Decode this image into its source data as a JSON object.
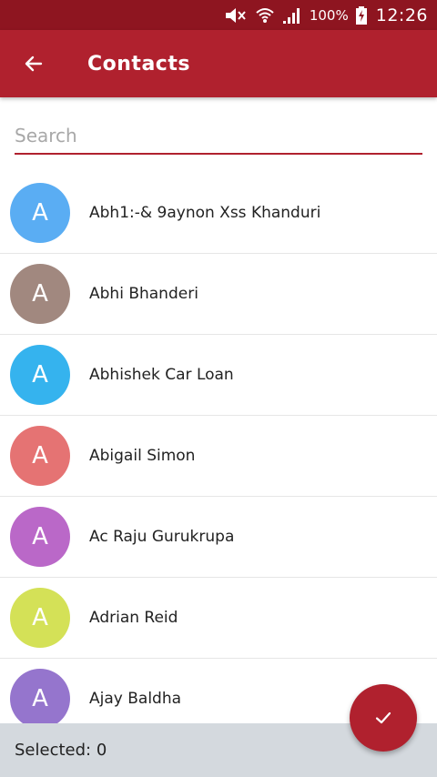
{
  "status_bar": {
    "battery": "100%",
    "time": "12:26",
    "icons": [
      "mute-icon",
      "wifi-icon",
      "signal-icon",
      "battery-charging-icon"
    ]
  },
  "app_bar": {
    "title": "Contacts",
    "back_icon": "arrow-left-icon"
  },
  "search": {
    "placeholder": "Search",
    "value": ""
  },
  "contacts": [
    {
      "initial": "A",
      "name": "Abh1:-& 9aynon Xss Khanduri",
      "color": "#5aadf3"
    },
    {
      "initial": "A",
      "name": "Abhi Bhanderi",
      "color": "#a1887f"
    },
    {
      "initial": "A",
      "name": "Abhishek Car Loan",
      "color": "#35b3ee"
    },
    {
      "initial": "A",
      "name": "Abigail Simon",
      "color": "#e57373"
    },
    {
      "initial": "A",
      "name": "Ac Raju Gurukrupa",
      "color": "#ba68c8"
    },
    {
      "initial": "A",
      "name": "Adrian Reid",
      "color": "#d4e157"
    },
    {
      "initial": "A",
      "name": "Ajay Baldha",
      "color": "#9575cd"
    }
  ],
  "footer": {
    "selected_label": "Selected: 0"
  },
  "fab": {
    "icon": "check-icon"
  },
  "colors": {
    "status_bar": "#8e1520",
    "primary": "#b0212e",
    "footer_bg": "#d4d9de"
  }
}
